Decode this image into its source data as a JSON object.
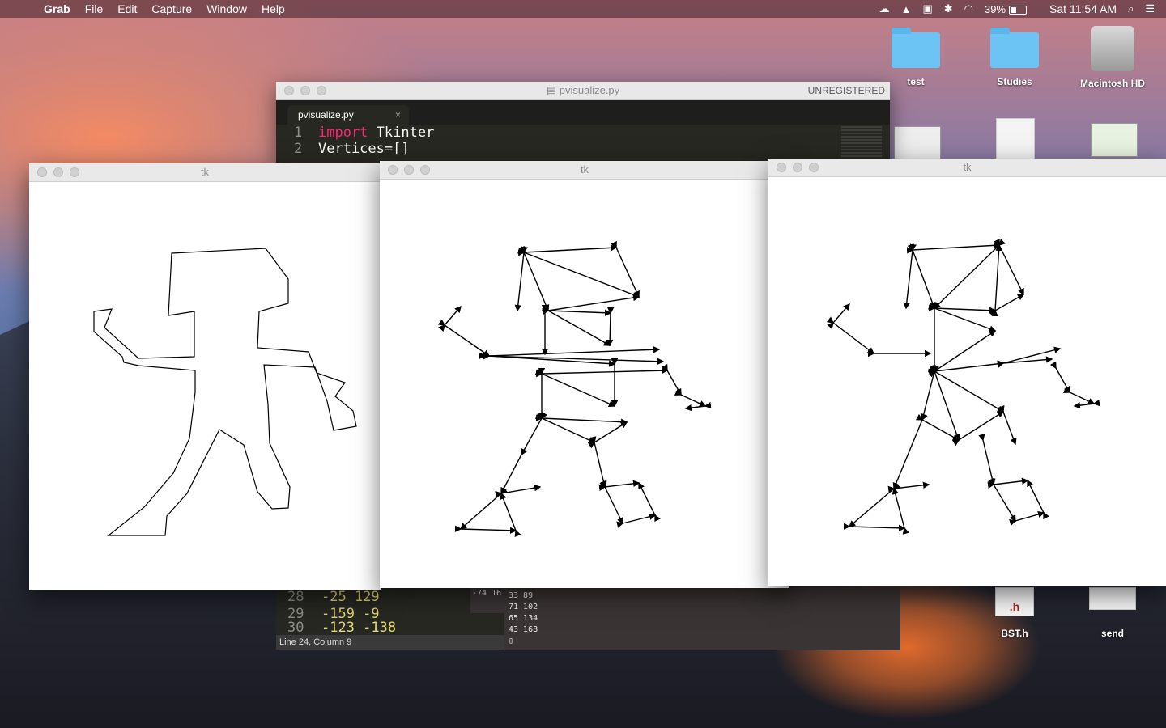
{
  "menubar": {
    "app": "Grab",
    "items": [
      "File",
      "Edit",
      "Capture",
      "Window",
      "Help"
    ],
    "battery": "39%",
    "clock": "Sat 11:54 AM"
  },
  "desktop": {
    "icons": [
      {
        "label": "test"
      },
      {
        "label": "Studies"
      },
      {
        "label": "Macintosh HD"
      },
      {
        "label": "BST.h"
      },
      {
        "label": "send"
      }
    ]
  },
  "editor": {
    "title": "pvisualize.py",
    "badge": "UNREGISTERED",
    "tab": "pvisualize.py",
    "lines": [
      {
        "n": "1",
        "kw": "import",
        "rest": " Tkinter"
      },
      {
        "n": "2",
        "kw": "",
        "rest": "Vertices=[]"
      }
    ],
    "lower_lines": [
      {
        "n": "28",
        "text": "-25 129"
      },
      {
        "n": "29",
        "text": "-159 -9"
      },
      {
        "n": "30",
        "text": "-123 -138"
      }
    ],
    "status": "Line 24, Column 9"
  },
  "terminal": {
    "small": "-74 16",
    "lines": [
      "33 89",
      "71 102",
      "65 134",
      "43 168"
    ]
  },
  "tk_windows": [
    {
      "title": "tk"
    },
    {
      "title": "tk"
    },
    {
      "title": "tk"
    }
  ]
}
